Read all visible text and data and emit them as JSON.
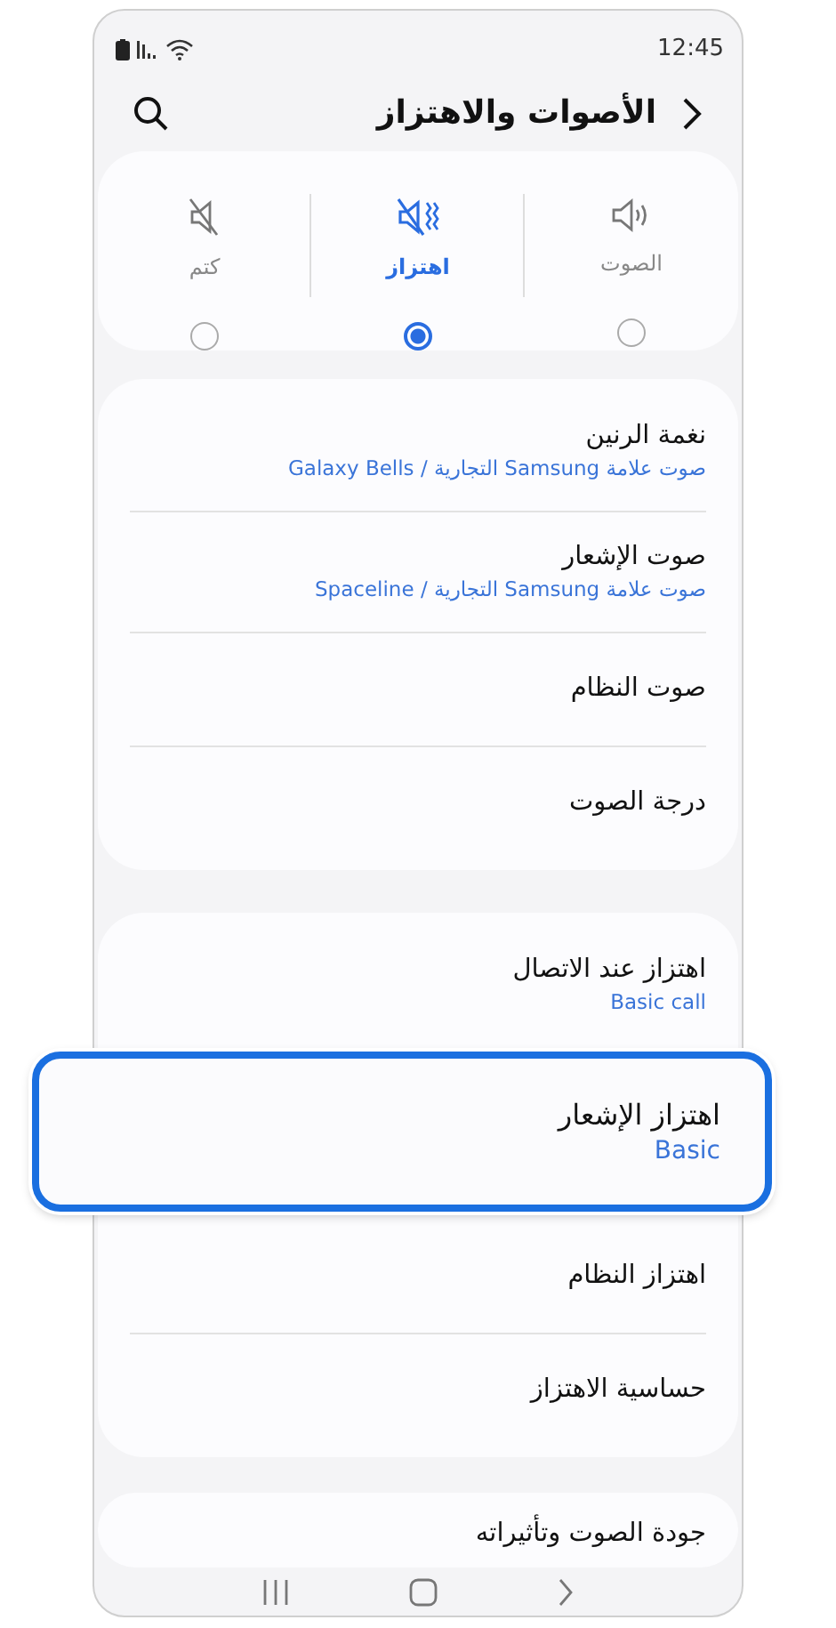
{
  "status_bar": {
    "time": "12:45"
  },
  "header": {
    "title": "الأصوات والاهتزاز"
  },
  "sound_modes": [
    {
      "kind": "sound",
      "label": "الصوت",
      "selected": false
    },
    {
      "kind": "vibrate",
      "label": "اهتزاز",
      "selected": true
    },
    {
      "kind": "mute",
      "label": "كتم",
      "selected": false
    }
  ],
  "groups": [
    {
      "items": [
        {
          "title": "نغمة الرنين",
          "subtitle": "صوت علامة Samsung التجارية / Galaxy Bells",
          "highlighted": false
        },
        {
          "title": "صوت الإشعار",
          "subtitle": "صوت علامة Samsung التجارية / Spaceline",
          "highlighted": false
        },
        {
          "title": "صوت النظام",
          "highlighted": false
        },
        {
          "title": "درجة الصوت",
          "highlighted": false
        }
      ]
    },
    {
      "items": [
        {
          "title": "اهتزاز عند الاتصال",
          "subtitle": "Basic call",
          "highlighted": false
        },
        {
          "title": "اهتزاز الإشعار",
          "subtitle": "Basic",
          "highlighted": true
        },
        {
          "title": "اهتزاز النظام",
          "highlighted": false
        },
        {
          "title": "حساسية الاهتزاز",
          "highlighted": false
        }
      ]
    },
    {
      "items": [
        {
          "title": "جودة الصوت وتأثيراته",
          "highlighted": false
        }
      ]
    }
  ]
}
